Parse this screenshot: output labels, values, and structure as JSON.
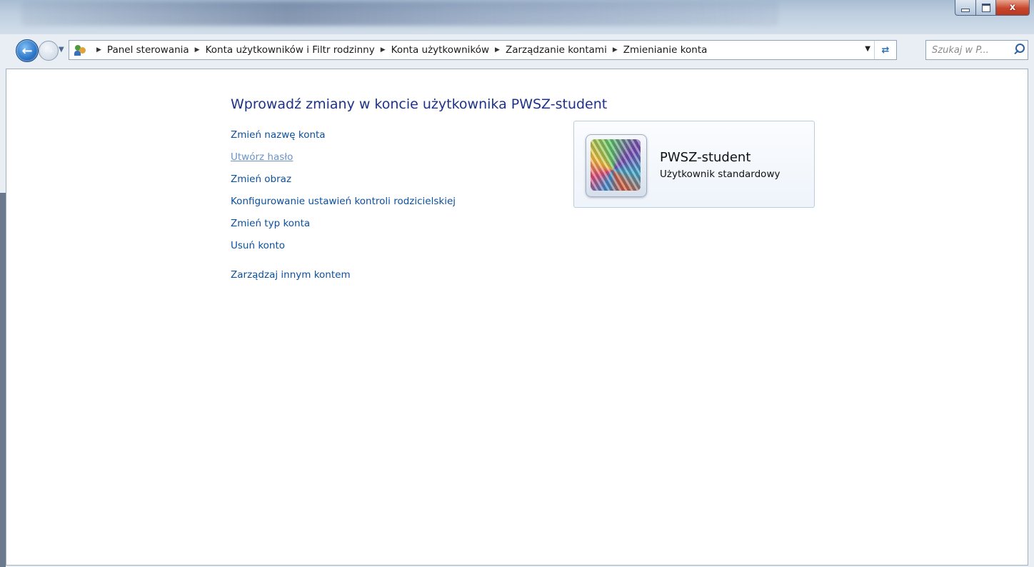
{
  "window": {
    "minimize_icon": "minimize-icon",
    "maximize_icon": "maximize-icon",
    "close_label": "x"
  },
  "nav": {
    "back_icon": "back-arrow-icon",
    "forward_icon": "forward-arrow-icon",
    "breadcrumb": [
      "Panel sterowania",
      "Konta użytkowników i Filtr rodzinny",
      "Konta użytkowników",
      "Zarządzanie kontami",
      "Zmienianie konta"
    ],
    "search_placeholder": "Szukaj w P..."
  },
  "main": {
    "heading": "Wprowadź zmiany w koncie użytkownika PWSZ-student",
    "links": [
      {
        "label": "Zmień nazwę konta"
      },
      {
        "label": "Utwórz hasło"
      },
      {
        "label": "Zmień obraz"
      },
      {
        "label": "Konfigurowanie ustawień kontroli rodzicielskiej"
      },
      {
        "label": "Zmień typ konta"
      },
      {
        "label": "Usuń konto"
      }
    ],
    "other_account_link": "Zarządzaj innym kontem"
  },
  "user_card": {
    "name": "PWSZ-student",
    "type": "Użytkownik standardowy"
  },
  "colors": {
    "link": "#0b4f9e",
    "heading": "#1e3287",
    "visited_link": "#6b93c7"
  }
}
